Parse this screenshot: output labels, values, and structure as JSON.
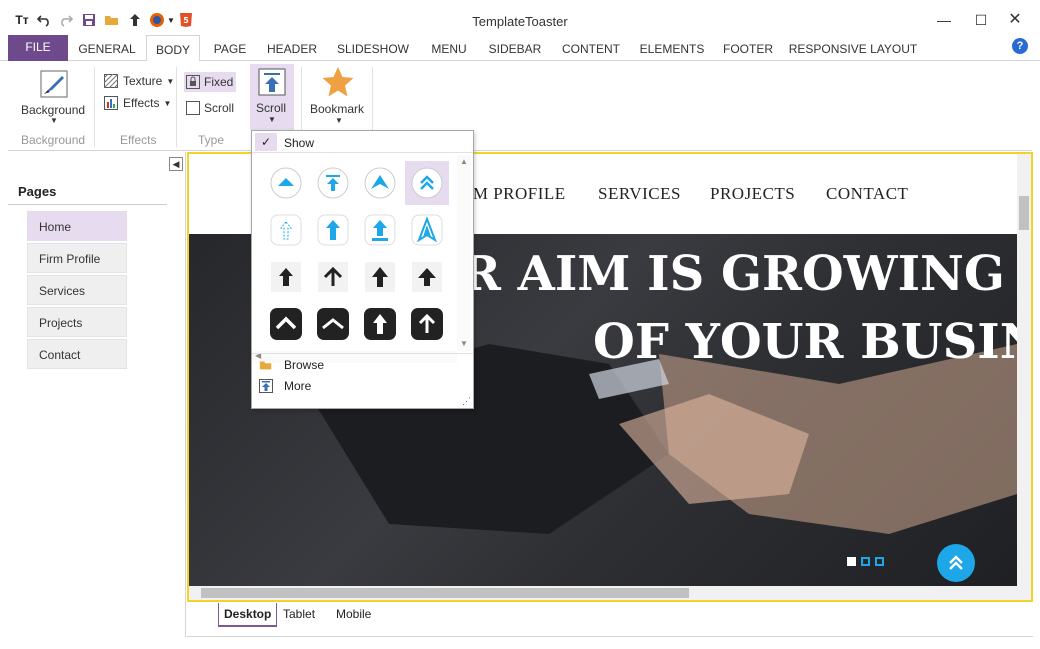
{
  "window": {
    "title": "TemplateToaster"
  },
  "tabs": [
    {
      "label": "FILE"
    },
    {
      "label": "GENERAL"
    },
    {
      "label": "BODY"
    },
    {
      "label": "PAGE"
    },
    {
      "label": "HEADER"
    },
    {
      "label": "SLIDESHOW"
    },
    {
      "label": "MENU"
    },
    {
      "label": "SIDEBAR"
    },
    {
      "label": "CONTENT"
    },
    {
      "label": "ELEMENTS"
    },
    {
      "label": "FOOTER"
    },
    {
      "label": "RESPONSIVE LAYOUT"
    }
  ],
  "ribbon": {
    "background": {
      "button": "Background",
      "group": "Background"
    },
    "effects": {
      "texture": "Texture",
      "effects": "Effects",
      "group": "Effects"
    },
    "type": {
      "fixed": "Fixed",
      "scroll": "Scroll",
      "group": "Type"
    },
    "scroll_button": "Scroll",
    "bookmark_button": "Bookmark",
    "help": "?"
  },
  "dropdown": {
    "show": "Show",
    "browse": "Browse",
    "more": "More"
  },
  "sidebar": {
    "title": "Pages",
    "pages": [
      {
        "label": "Home"
      },
      {
        "label": "Firm Profile"
      },
      {
        "label": "Services"
      },
      {
        "label": "Projects"
      },
      {
        "label": "Contact"
      }
    ]
  },
  "site": {
    "nav": [
      {
        "label": "RM PROFILE"
      },
      {
        "label": "SERVICES"
      },
      {
        "label": "PROJECTS"
      },
      {
        "label": "CONTACT"
      }
    ],
    "hero_line1": "R AIM IS GROWING A",
    "hero_line2": "OF YOUR BUSIN"
  },
  "devices": [
    {
      "label": "Desktop"
    },
    {
      "label": "Tablet"
    },
    {
      "label": "Mobile"
    }
  ],
  "colors": {
    "accent": "#6e4a8c",
    "canvas_border": "#f3d229",
    "scroll_icon": "#1ea7e8"
  }
}
